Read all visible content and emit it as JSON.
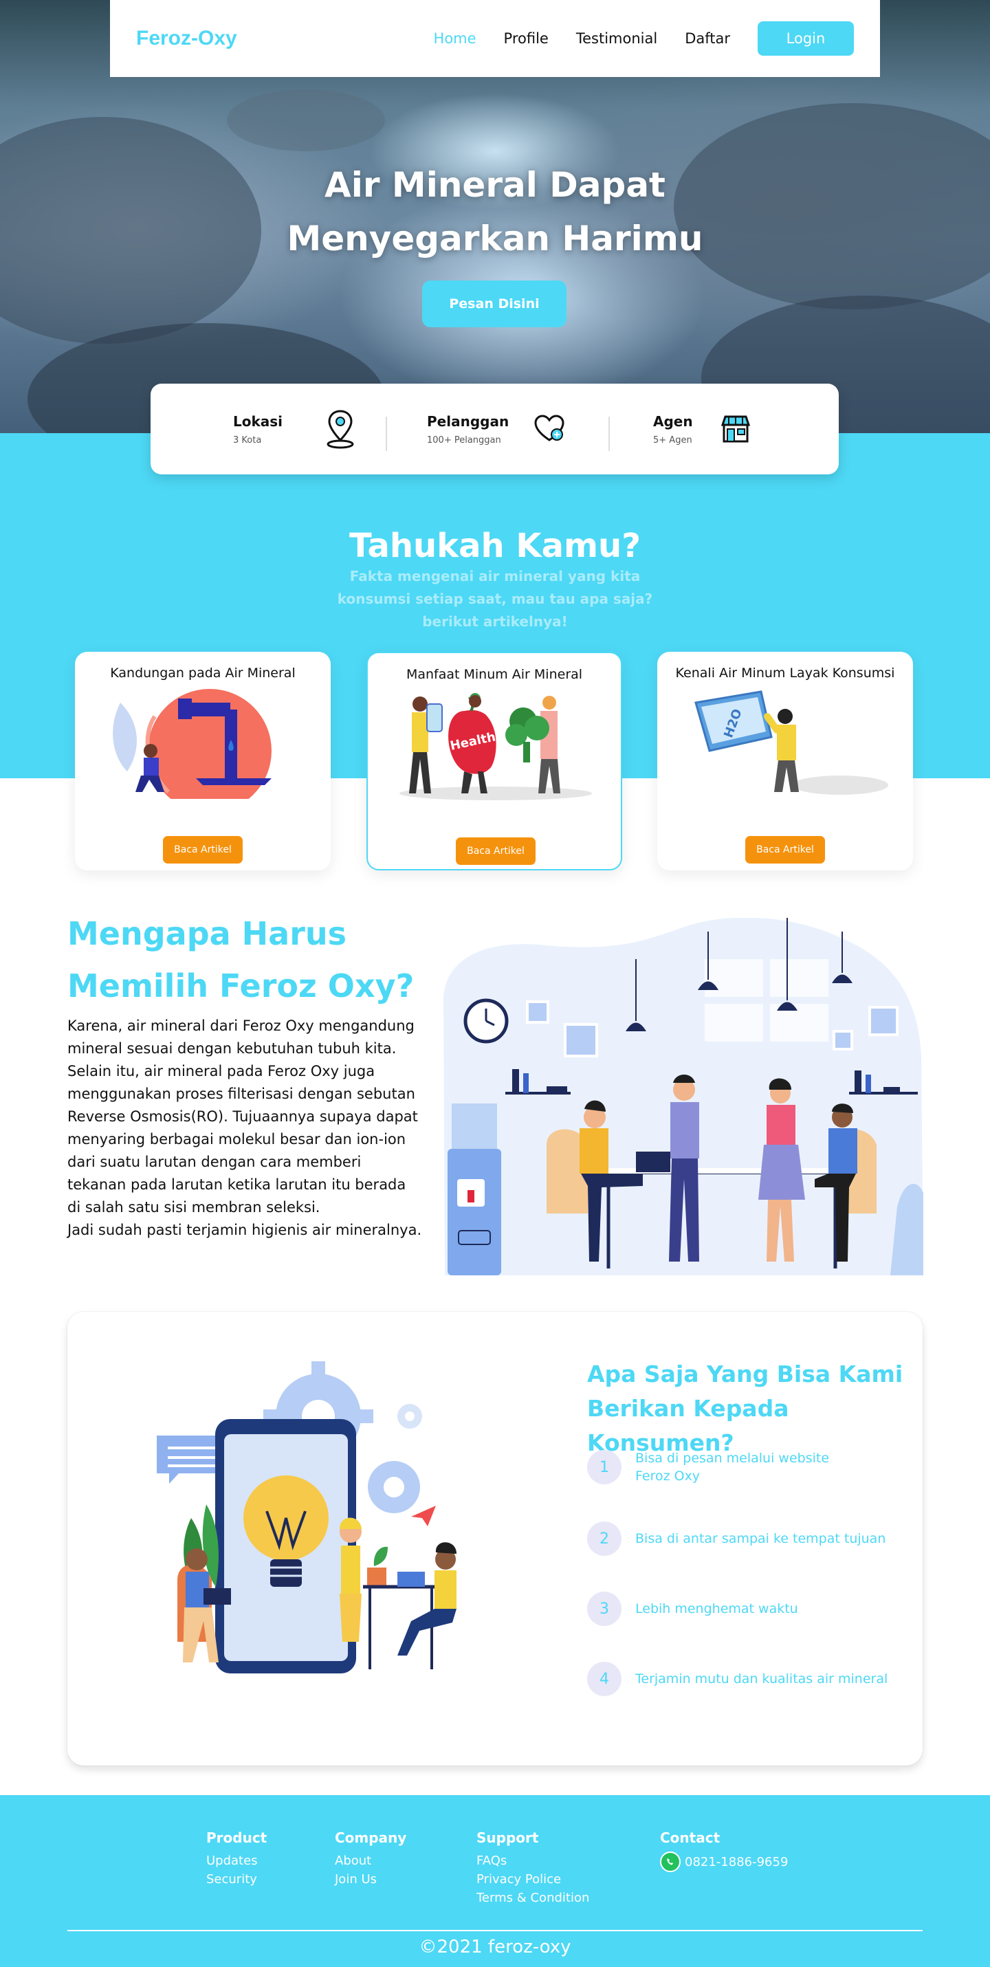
{
  "nav": {
    "brand": "Feroz-Oxy",
    "links": [
      "Home",
      "Profile",
      "Testimonial",
      "Daftar"
    ],
    "login": "Login",
    "active": "Home"
  },
  "hero": {
    "title_line1": "Air Mineral Dapat",
    "title_line2": "Menyegarkan Harimu",
    "cta": "Pesan Disini"
  },
  "stats": [
    {
      "title": "Lokasi",
      "sub": "3 Kota",
      "icon": "location-pin-icon"
    },
    {
      "title": "Pelanggan",
      "sub": "100+ Pelanggan",
      "icon": "heart-plus-icon"
    },
    {
      "title": "Agen",
      "sub": "5+ Agen",
      "icon": "store-icon"
    }
  ],
  "tahukah": {
    "title": "Tahukah Kamu?",
    "subtitle_line1": "Fakta mengenai air mineral yang kita",
    "subtitle_line2": "konsumsi setiap saat, mau tau apa saja?",
    "subtitle_line3": "berikut artikelnya!"
  },
  "articles": [
    {
      "title": "Kandungan pada Air Mineral",
      "button": "Baca Artikel"
    },
    {
      "title": "Manfaat Minum Air Mineral",
      "button": "Baca Artikel",
      "art_text": "Health"
    },
    {
      "title": "Kenali Air Minum Layak Konsumsi",
      "button": "Baca Artikel",
      "art_text": "H2O"
    }
  ],
  "why": {
    "title_line1": "Mengapa Harus",
    "title_line2": "Memilih Feroz Oxy?",
    "body": [
      "Karena, air mineral dari Feroz Oxy mengandung",
      "mineral sesuai dengan kebutuhan tubuh kita.",
      "Selain itu, air mineral pada Feroz Oxy juga",
      "menggunakan proses filterisasi dengan sebutan",
      "Reverse Osmosis(RO). Tujuaannya supaya dapat",
      "menyaring berbagai molekul besar dan ion-ion",
      "dari suatu larutan dengan cara memberi",
      "tekanan pada larutan ketika larutan itu berada",
      "di salah satu sisi membran  seleksi.",
      "Jadi sudah pasti terjamin higienis air mineralnya."
    ]
  },
  "services": {
    "title_line1": "Apa Saja Yang Bisa Kami",
    "title_line2": "Berikan Kepada Konsumen?",
    "items": [
      {
        "num": "1",
        "line1": "Bisa di pesan melalui website",
        "line2": "Feroz Oxy"
      },
      {
        "num": "2",
        "line1": "Bisa di antar sampai ke tempat tujuan",
        "line2": ""
      },
      {
        "num": "3",
        "line1": "Lebih menghemat waktu",
        "line2": ""
      },
      {
        "num": "4",
        "line1": "Terjamin mutu dan kualitas air mineral",
        "line2": ""
      }
    ]
  },
  "footer": {
    "product": {
      "head": "Product",
      "links": [
        "Updates",
        "Security"
      ]
    },
    "company": {
      "head": "Company",
      "links": [
        "About",
        "Join Us"
      ]
    },
    "support": {
      "head": "Support",
      "links": [
        "FAQs",
        "Privacy Police",
        "Terms & Condition"
      ]
    },
    "contact": {
      "head": "Contact",
      "phone": "0821-1886-9659",
      "icon": "whatsapp-icon"
    },
    "copyright": "©2021 feroz-oxy"
  },
  "colors": {
    "accent": "#4dd8f5",
    "button_orange": "#f5920d",
    "whatsapp": "#22c15e",
    "number_badge": "#e8e7f8"
  }
}
